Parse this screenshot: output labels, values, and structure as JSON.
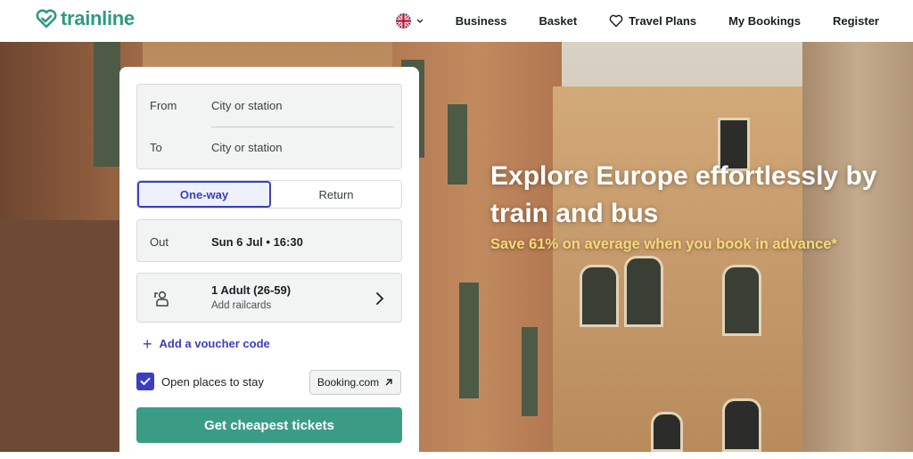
{
  "header": {
    "logo_text": "trainline",
    "language_flag": "uk-flag-icon",
    "nav": [
      "Business",
      "Basket",
      "Travel Plans",
      "My Bookings",
      "Register"
    ]
  },
  "hero": {
    "title": "Explore Europe effortlessly by train and bus",
    "subtitle": "Save 61% on average when you book in advance*"
  },
  "search": {
    "from_label": "From",
    "from_placeholder": "City or station",
    "to_label": "To",
    "to_placeholder": "City or station",
    "trip_types": [
      "One-way",
      "Return"
    ],
    "selected_trip_type": "One-way",
    "out_label": "Out",
    "out_value": "Sun 6 Jul • 16:30",
    "passengers": "1 Adult (26-59)",
    "railcards": "Add railcards",
    "voucher": "Add a voucher code",
    "stay_label": "Open places to stay",
    "stay_checked": true,
    "booking_label": "Booking.com",
    "cta": "Get cheapest tickets"
  },
  "colors": {
    "brand": "#2e9a82",
    "accent": "#3a3fbf",
    "cta": "#3b9c86",
    "highlight": "#f6d977"
  }
}
